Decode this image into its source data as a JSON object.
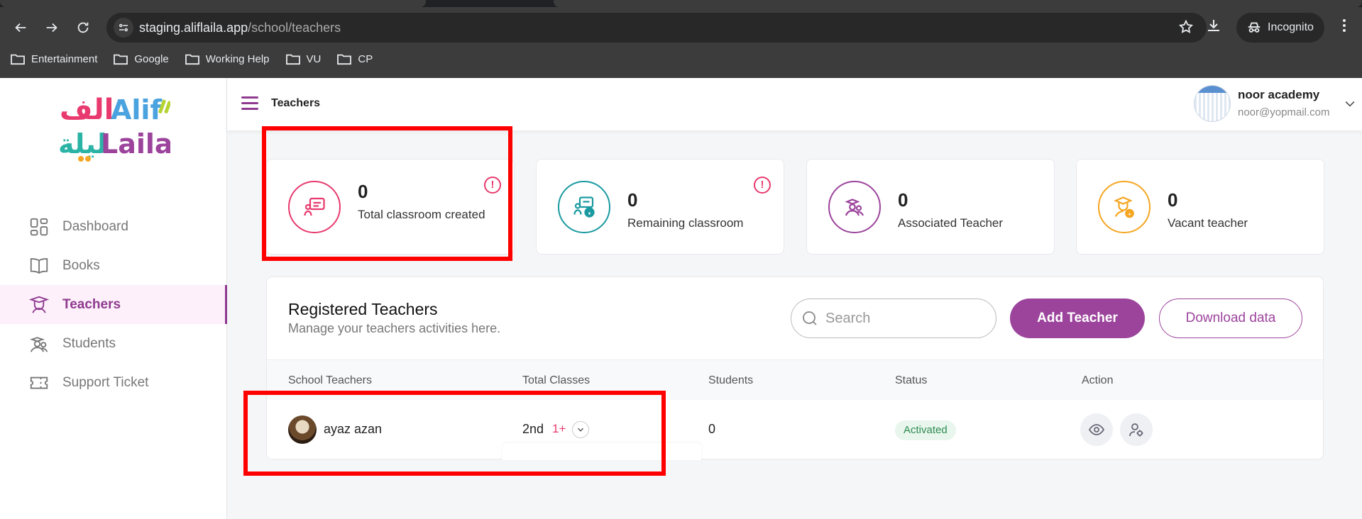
{
  "browser": {
    "url_host": "staging.aliflaila.app",
    "url_path": "/school/teachers",
    "incognito_label": "Incognito",
    "bookmarks": [
      {
        "label": "Entertainment",
        "icon": "folder-icon"
      },
      {
        "label": "Google",
        "icon": "folder-icon"
      },
      {
        "label": "Working Help",
        "icon": "folder-icon"
      },
      {
        "label": "VU",
        "icon": "folder-icon"
      },
      {
        "label": "CP",
        "icon": "folder-icon"
      }
    ]
  },
  "brand": {
    "logo_text_top": "Alif",
    "logo_text_bottom": "Laila",
    "logo_arabic_top": "الف",
    "logo_arabic_bottom": "ليلة"
  },
  "sidebar": {
    "items": [
      {
        "label": "Dashboard",
        "icon": "dashboard-icon",
        "active": false
      },
      {
        "label": "Books",
        "icon": "book-icon",
        "active": false
      },
      {
        "label": "Teachers",
        "icon": "teacher-icon",
        "active": true
      },
      {
        "label": "Students",
        "icon": "students-icon",
        "active": false
      },
      {
        "label": "Support Ticket",
        "icon": "ticket-icon",
        "active": false
      }
    ]
  },
  "header": {
    "title": "Teachers",
    "user_name": "noor academy",
    "user_email": "noor@yopmail.com"
  },
  "stats": [
    {
      "value": "0",
      "label": "Total classroom created",
      "color": "#e83a6e",
      "has_info": true
    },
    {
      "value": "0",
      "label": "Remaining classroom",
      "color": "#1a9aa0",
      "has_info": true
    },
    {
      "value": "0",
      "label": "Associated Teacher",
      "color": "#9c449c",
      "has_info": false
    },
    {
      "value": "0",
      "label": "Vacant teacher",
      "color": "#f5a623",
      "has_info": false
    }
  ],
  "teachers_panel": {
    "title": "Registered Teachers",
    "subtitle": "Manage your teachers activities here.",
    "search_placeholder": "Search",
    "add_label": "Add Teacher",
    "download_label": "Download data",
    "columns": [
      "School Teachers",
      "Total Classes",
      "Students",
      "Status",
      "Action"
    ],
    "rows": [
      {
        "name": "ayaz azan",
        "classes": "2nd",
        "more_classes": "1+",
        "students": "0",
        "status": "Activated"
      }
    ]
  },
  "colors": {
    "brand_purple": "#9c449c",
    "highlight_red": "#ff0000"
  }
}
